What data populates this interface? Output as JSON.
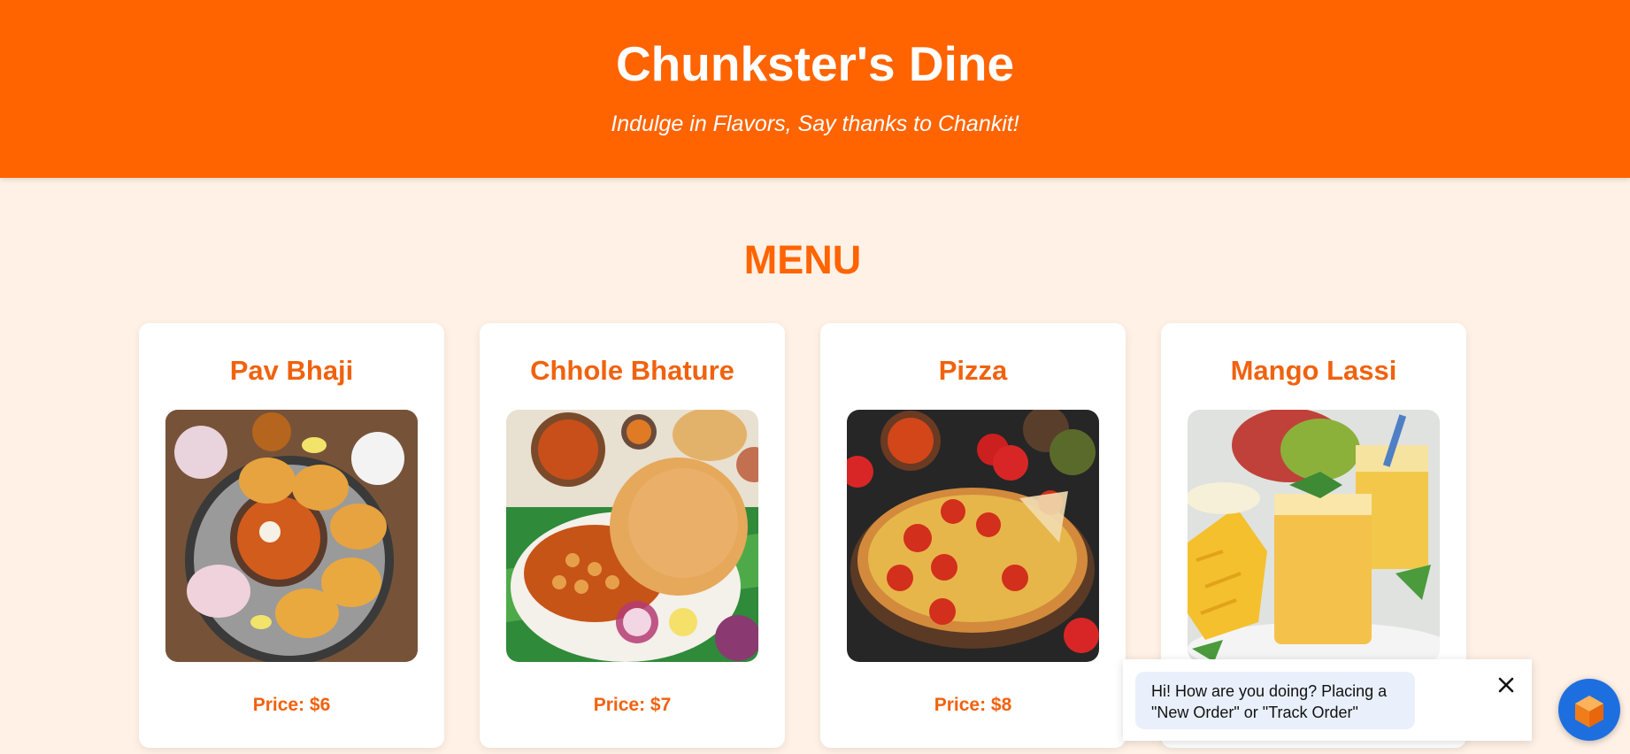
{
  "header": {
    "title": "Chunkster's Dine",
    "tagline": "Indulge in Flavors, Say thanks to Chankit!"
  },
  "menu": {
    "heading": "MENU",
    "items": [
      {
        "name": "Pav Bhaji",
        "price": "Price: $6",
        "image_icon": "pav-bhaji-photo"
      },
      {
        "name": "Chhole Bhature",
        "price": "Price: $7",
        "image_icon": "chhole-bhature-photo"
      },
      {
        "name": "Pizza",
        "price": "Price: $8",
        "image_icon": "pizza-photo"
      },
      {
        "name": "Mango Lassi",
        "price": "",
        "image_icon": "mango-lassi-photo"
      }
    ]
  },
  "chat": {
    "message": "Hi! How are you doing? Placing a \"New Order\" or \"Track Order\"",
    "close_icon": "close-icon",
    "launcher_icon": "chat-cube-icon"
  },
  "colors": {
    "brand_orange": "#ff6400",
    "background": "#fff1e5",
    "chat_blue": "#1d6fe0"
  }
}
